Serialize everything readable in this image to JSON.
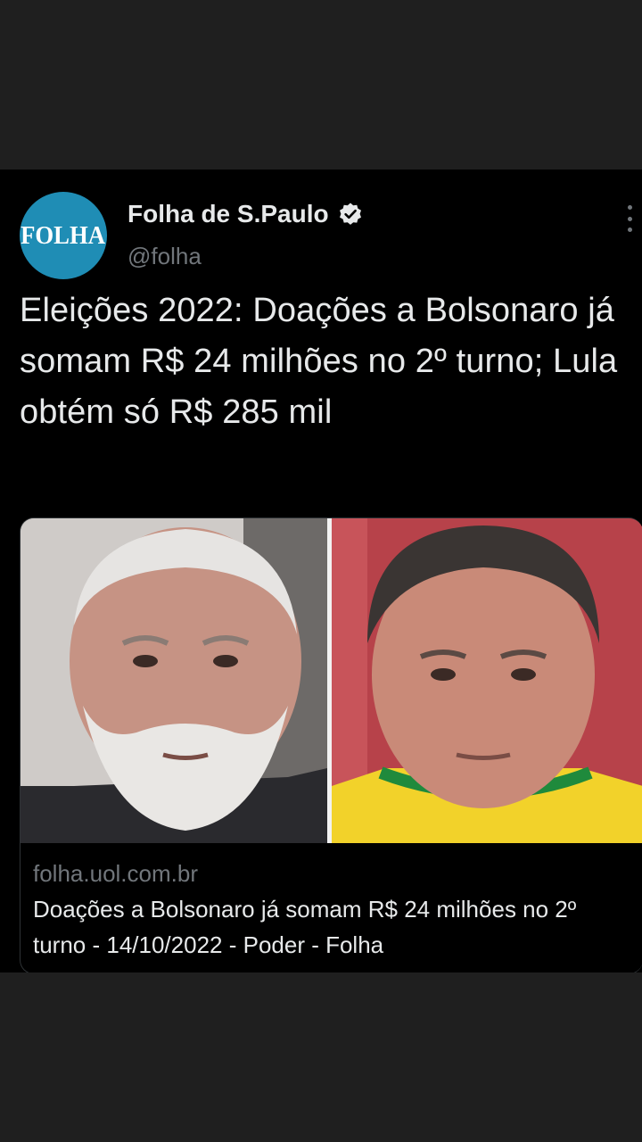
{
  "author": {
    "avatar_text": "FOLHA",
    "display_name": "Folha de S.Paulo",
    "handle": "@folha",
    "verified": true
  },
  "tweet": {
    "text": "Eleições 2022: Doações a Bolsonaro já somam R$ 24 milhões no 2º turno; Lula obtém só R$ 285 mil"
  },
  "card": {
    "domain": "folha.uol.com.br",
    "title": "Doações a Bolsonaro já somam R$ 24 milhões no 2º turno - 14/10/2022 - Poder - Folha",
    "image_left": "portrait of Lula",
    "image_right": "portrait of Bolsonaro"
  },
  "icons": {
    "verified": "verified-badge-icon",
    "more": "more-options-icon"
  },
  "colors": {
    "background": "#000000",
    "frame": "#1f1f1f",
    "avatar_bg": "#1f8db5",
    "secondary_text": "#71767b",
    "primary_text": "#e7e9ea"
  }
}
